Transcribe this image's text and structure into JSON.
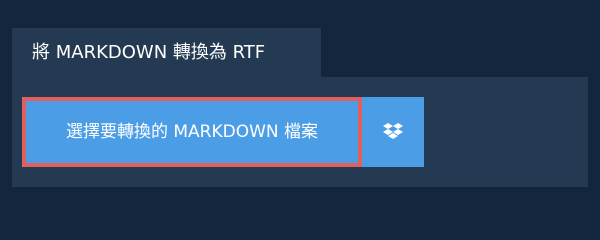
{
  "tab": {
    "title": "將 MARKDOWN 轉換為 RTF"
  },
  "main": {
    "select_button_label": "選擇要轉換的 MARKDOWN 檔案",
    "dropbox_icon": "dropbox-icon"
  },
  "colors": {
    "page_background": "#13263d",
    "panel_background": "#233a52",
    "button_background": "#4b9ee6",
    "button_highlight_border": "#e0605f",
    "text": "#ffffff"
  }
}
